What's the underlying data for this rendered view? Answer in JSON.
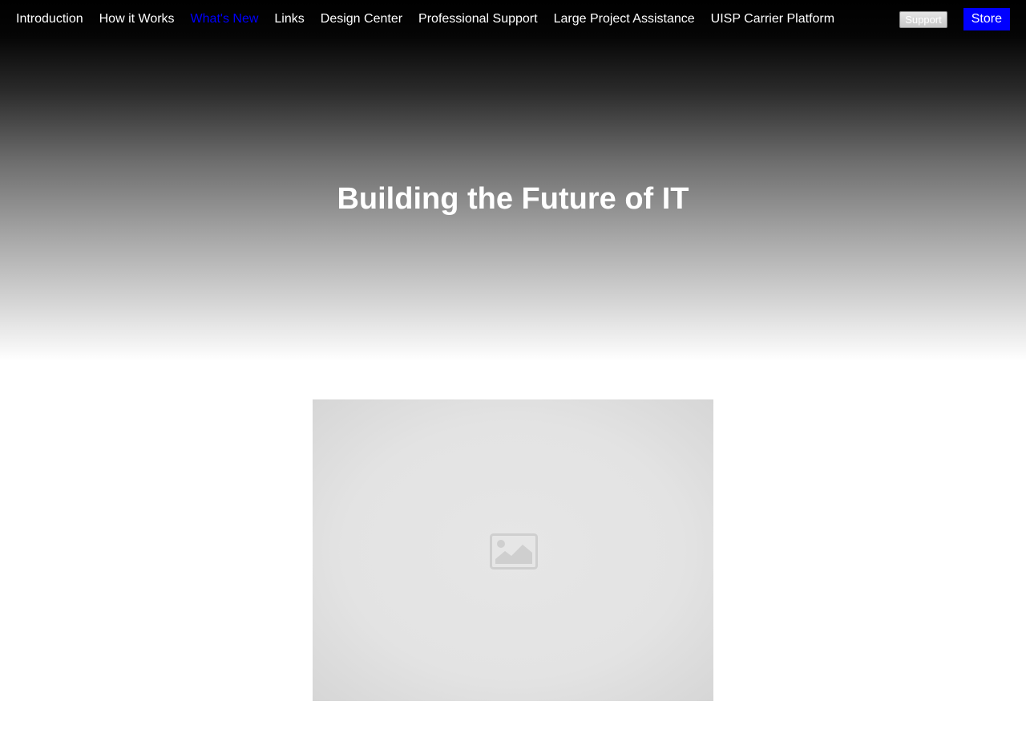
{
  "nav": {
    "links": [
      {
        "label": "Introduction"
      },
      {
        "label": "How it Works"
      },
      {
        "label": "What's New",
        "active": true
      },
      {
        "label": "Links"
      },
      {
        "label": "Design Center"
      },
      {
        "label": "Professional Support"
      },
      {
        "label": "Large Project Assistance"
      },
      {
        "label": "UISP Carrier Platform"
      }
    ],
    "support_label": "Support",
    "store_label": "Store"
  },
  "hero": {
    "title": "Building the Future of IT"
  },
  "media": {
    "icon": "image-placeholder-icon"
  },
  "colors": {
    "active_link": "#0000ff",
    "store_button": "#0000ff",
    "nav_text": "#ffffff"
  }
}
